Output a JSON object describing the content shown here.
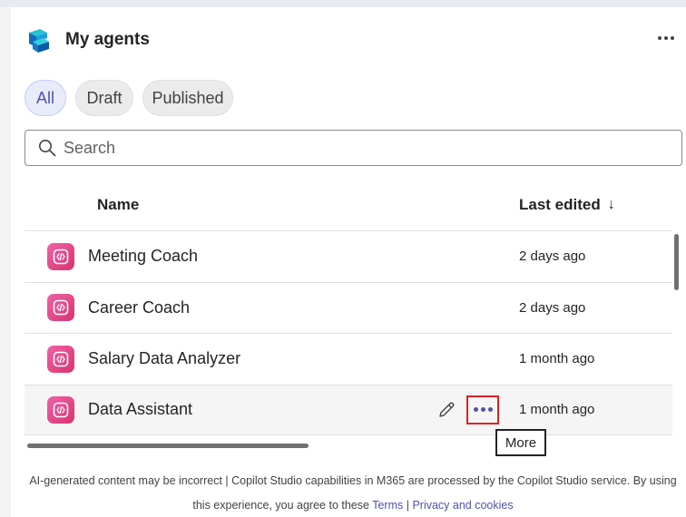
{
  "header": {
    "title": "My agents",
    "logo_icon": "copilot-studio-logo-icon",
    "more_icon": "more-horizontal-icon"
  },
  "filters": [
    {
      "label": "All",
      "selected": true
    },
    {
      "label": "Draft",
      "selected": false
    },
    {
      "label": "Published",
      "selected": false
    }
  ],
  "search": {
    "placeholder": "Search",
    "value": ""
  },
  "table": {
    "columns": {
      "name": "Name",
      "last_edited": "Last edited",
      "sort_icon": "arrow-down-icon"
    },
    "rows": [
      {
        "name": "Meeting Coach",
        "edited": "2 days ago"
      },
      {
        "name": "Career Coach",
        "edited": "2 days ago"
      },
      {
        "name": "Salary Data Analyzer",
        "edited": "1 month ago"
      },
      {
        "name": "Data Assistant",
        "edited": "1 month ago",
        "hovered": true
      }
    ]
  },
  "tooltip": {
    "text": "More"
  },
  "footer": {
    "text_prefix": "AI-generated content may be incorrect | Copilot Studio capabilities in M365 are processed by the Copilot Studio service. By using this experience, you agree to these ",
    "terms_label": "Terms",
    "separator": " | ",
    "privacy_label": "Privacy and cookies"
  },
  "colors": {
    "accent": "#4f52b2",
    "agent_icon": "#e44c8c",
    "highlight_border": "#e02020"
  }
}
